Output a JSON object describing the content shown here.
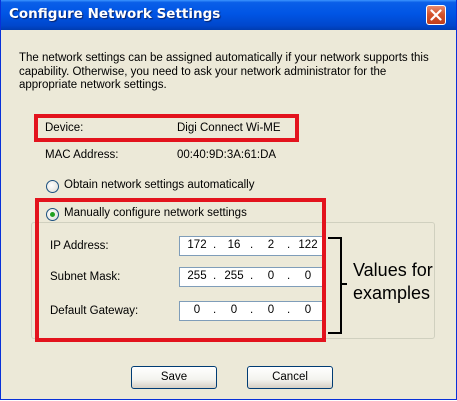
{
  "window": {
    "title": "Configure Network Settings"
  },
  "description": "The network settings can be assigned automatically if your network supports this capability. Otherwise, you need to ask your network administrator for the appropriate network settings.",
  "device": {
    "label": "Device:",
    "value": "Digi Connect Wi-ME"
  },
  "mac": {
    "label": "MAC Address:",
    "value": "00:40:9D:3A:61:DA"
  },
  "options": {
    "automatic_label": "Obtain network settings automatically",
    "manual_label": "Manually configure network settings",
    "selected": "manual"
  },
  "network": {
    "ip_label": "IP Address:",
    "ip": [
      "172",
      "16",
      "2",
      "122"
    ],
    "subnet_label": "Subnet Mask:",
    "subnet": [
      "255",
      "255",
      "0",
      "0"
    ],
    "gateway_label": "Default Gateway:",
    "gateway": [
      "0",
      "0",
      "0",
      "0"
    ]
  },
  "buttons": {
    "save": "Save",
    "cancel": "Cancel"
  },
  "annotation": {
    "text": "Values for examples",
    "highlight_color": "#e3131d"
  },
  "colors": {
    "titlebar": "#0055e5",
    "dialog_bg": "#ece9d8",
    "radio_selected": "#21a121"
  },
  "icons": {
    "close": "close-icon"
  }
}
